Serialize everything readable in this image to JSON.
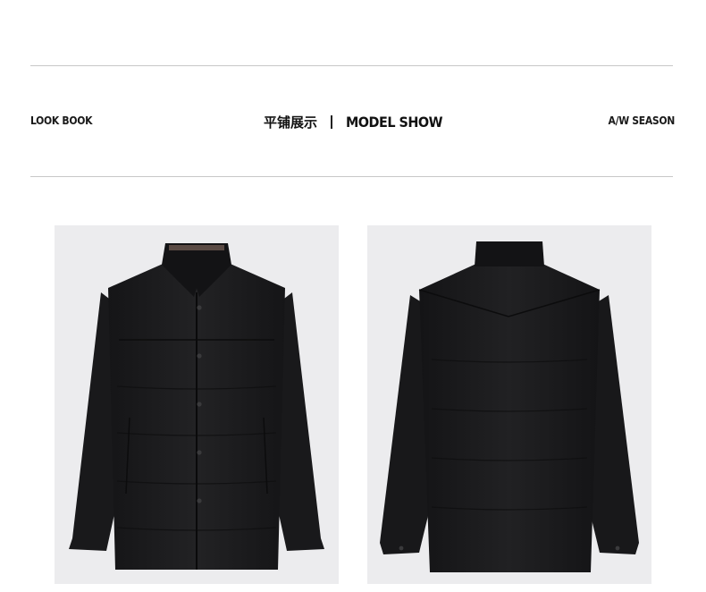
{
  "header": {
    "left_label": "LOOK BOOK",
    "center_cn": "平铺展示",
    "center_en": "MODEL SHOW",
    "right_label": "A/W SEASON"
  },
  "colors": {
    "background": "#ffffff",
    "rule": "#c8c8c8",
    "photo_bg": "#ececee",
    "jacket": "#1b1b1d"
  },
  "gallery": [
    {
      "view": "front",
      "icon": "jacket-front-image"
    },
    {
      "view": "back",
      "icon": "jacket-back-image"
    }
  ]
}
